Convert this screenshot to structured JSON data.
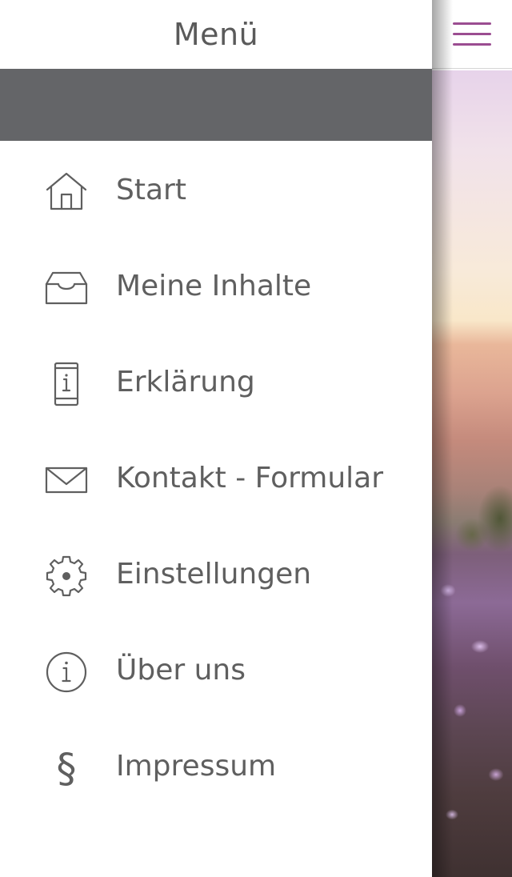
{
  "drawer": {
    "title": "Menü",
    "banner_color": "#646568",
    "items": [
      {
        "label": "Start",
        "icon": "home-icon"
      },
      {
        "label": "Meine Inhalte",
        "icon": "inbox-tray-icon"
      },
      {
        "label": "Erklärung",
        "icon": "phone-info-icon"
      },
      {
        "label": "Kontakt - Formular",
        "icon": "envelope-icon"
      },
      {
        "label": "Einstellungen",
        "icon": "gear-icon"
      },
      {
        "label": "Über uns",
        "icon": "info-circle-icon"
      },
      {
        "label": "Impressum",
        "icon": "section-sign-icon",
        "glyph": "§"
      }
    ]
  },
  "header": {
    "menu_button_icon": "hamburger-menu-icon",
    "accent_color": "#9b4d91"
  },
  "colors": {
    "text": "#5f5f5f",
    "icon_stroke": "#5f5f5f"
  }
}
